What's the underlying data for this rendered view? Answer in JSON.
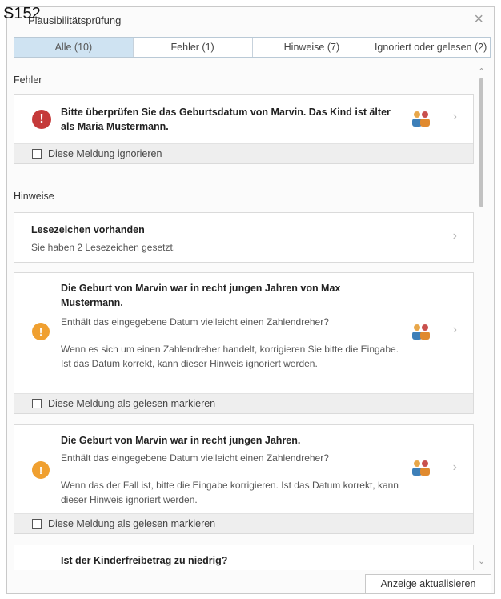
{
  "corner_label": "S152",
  "window": {
    "title": "Plausibilitätsprüfung",
    "close_glyph": "×"
  },
  "tabs": [
    {
      "label": "Alle (10)",
      "active": true
    },
    {
      "label": "Fehler (1)",
      "active": false
    },
    {
      "label": "Hinweise (7)",
      "active": false
    },
    {
      "label": "Ignoriert oder gelesen (2)",
      "active": false
    }
  ],
  "sections": {
    "errors_heading": "Fehler",
    "hints_heading": "Hinweise"
  },
  "messages": {
    "error_1": {
      "title": "Bitte überprüfen Sie das Geburtsdatum von Marvin. Das Kind ist älter als Maria Mustermann.",
      "footer": "Diese Meldung ignorieren"
    },
    "bookmark": {
      "title": "Lesezeichen vorhanden",
      "text": "Sie haben 2 Lesezeichen gesetzt."
    },
    "hint_1": {
      "title": "Die Geburt von Marvin war in recht jungen Jahren von Max Mustermann.",
      "question": "Enthält das eingegebene Datum vielleicht einen Zahlendreher?",
      "text": "Wenn es sich um einen Zahlendreher handelt, korrigieren Sie bitte die Eingabe. Ist das Datum korrekt, kann dieser Hinweis ignoriert werden.",
      "footer": "Diese Meldung als gelesen markieren"
    },
    "hint_2": {
      "title": "Die Geburt von Marvin war in recht jungen Jahren.",
      "question": "Enthält das eingegebene Datum vielleicht einen Zahlendreher?",
      "text": "Wenn das der Fall ist, bitte die Eingabe korrigieren. Ist das Datum korrekt, kann dieser Hinweis ignoriert werden.",
      "footer": "Diese Meldung als gelesen markieren"
    },
    "hint_3": {
      "title": "Ist der Kinderfreibetrag zu niedrig?"
    }
  },
  "buttons": {
    "refresh": "Anzeige aktualisieren"
  },
  "icons": {
    "error": "!",
    "warning": "!",
    "chevron": "›",
    "scroll_up": "⌃",
    "scroll_down": "⌄"
  },
  "colors": {
    "error": "#c53a3a",
    "warning": "#f0a030",
    "active_tab": "#cfe3f2"
  }
}
